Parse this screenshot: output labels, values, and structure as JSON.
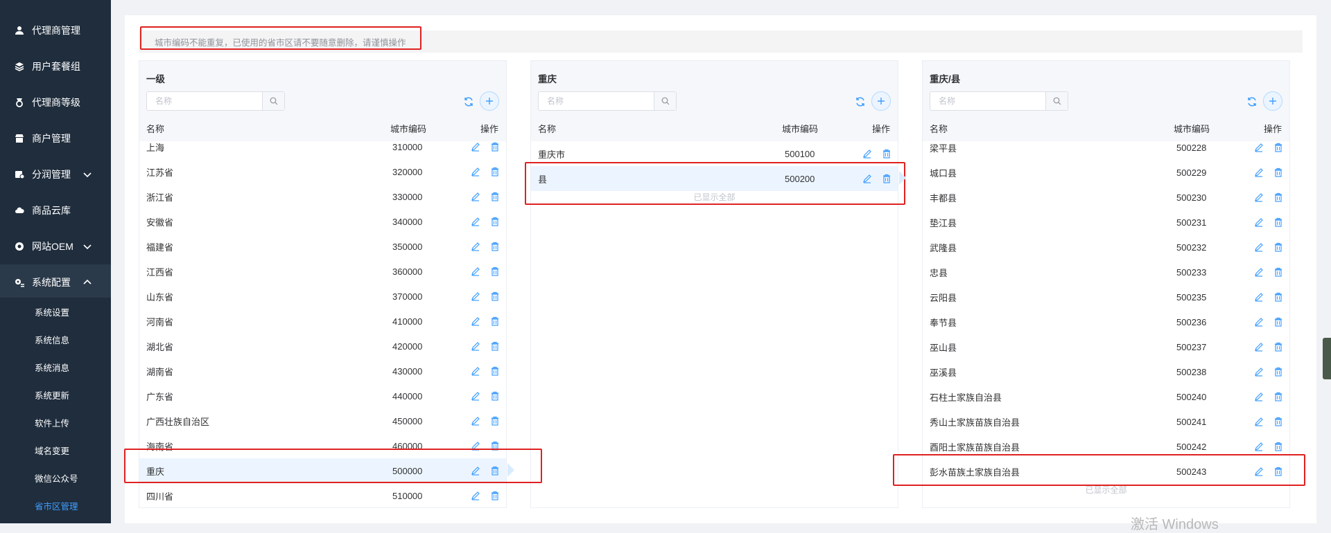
{
  "sidebar": {
    "items": [
      {
        "label": "代理商管理",
        "icon": "user-icon"
      },
      {
        "label": "用户套餐组",
        "icon": "layers-icon"
      },
      {
        "label": "代理商等级",
        "icon": "medal-icon"
      },
      {
        "label": "商户管理",
        "icon": "store-icon"
      },
      {
        "label": "分润管理",
        "icon": "money-icon"
      },
      {
        "label": "商品云库",
        "icon": "cloud-icon"
      },
      {
        "label": "网站OEM",
        "icon": "globe-icon"
      },
      {
        "label": "系统配置",
        "icon": "settings-icon"
      }
    ],
    "subitems": [
      "系统设置",
      "系统信息",
      "系统消息",
      "系统更新",
      "软件上传",
      "域名变更",
      "微信公众号",
      "省市区管理"
    ],
    "active_sub": "省市区管理",
    "accent": "#409eff"
  },
  "notice": "城市编码不能重复，已使用的省市区请不要随意删除，请谨慎操作",
  "search_placeholder": "名称",
  "columns": {
    "name": "名称",
    "code": "城市编码",
    "ops": "操作"
  },
  "panels": [
    {
      "title": "一级",
      "rows": [
        {
          "name": "上海",
          "code": "310000"
        },
        {
          "name": "江苏省",
          "code": "320000"
        },
        {
          "name": "浙江省",
          "code": "330000"
        },
        {
          "name": "安徽省",
          "code": "340000"
        },
        {
          "name": "福建省",
          "code": "350000"
        },
        {
          "name": "江西省",
          "code": "360000"
        },
        {
          "name": "山东省",
          "code": "370000"
        },
        {
          "name": "河南省",
          "code": "410000"
        },
        {
          "name": "湖北省",
          "code": "420000"
        },
        {
          "name": "湖南省",
          "code": "430000"
        },
        {
          "name": "广东省",
          "code": "440000"
        },
        {
          "name": "广西壮族自治区",
          "code": "450000"
        },
        {
          "name": "海南省",
          "code": "460000"
        },
        {
          "name": "重庆",
          "code": "500000"
        },
        {
          "name": "四川省",
          "code": "510000"
        }
      ],
      "selected": "重庆"
    },
    {
      "title": "重庆",
      "rows": [
        {
          "name": "重庆市",
          "code": "500100"
        },
        {
          "name": "县",
          "code": "500200"
        }
      ],
      "selected": "县",
      "footer": "已显示全部"
    },
    {
      "title": "重庆/县",
      "rows": [
        {
          "name": "梁平县",
          "code": "500228"
        },
        {
          "name": "城口县",
          "code": "500229"
        },
        {
          "name": "丰都县",
          "code": "500230"
        },
        {
          "name": "垫江县",
          "code": "500231"
        },
        {
          "name": "武隆县",
          "code": "500232"
        },
        {
          "name": "忠县",
          "code": "500233"
        },
        {
          "name": "云阳县",
          "code": "500235"
        },
        {
          "name": "奉节县",
          "code": "500236"
        },
        {
          "name": "巫山县",
          "code": "500237"
        },
        {
          "name": "巫溪县",
          "code": "500238"
        },
        {
          "name": "石柱土家族自治县",
          "code": "500240"
        },
        {
          "name": "秀山土家族苗族自治县",
          "code": "500241"
        },
        {
          "name": "酉阳土家族苗族自治县",
          "code": "500242"
        },
        {
          "name": "彭水苗族土家族自治县",
          "code": "500243"
        }
      ],
      "selected": null,
      "footer": "已显示全部"
    }
  ],
  "watermark": "激活 Windows"
}
